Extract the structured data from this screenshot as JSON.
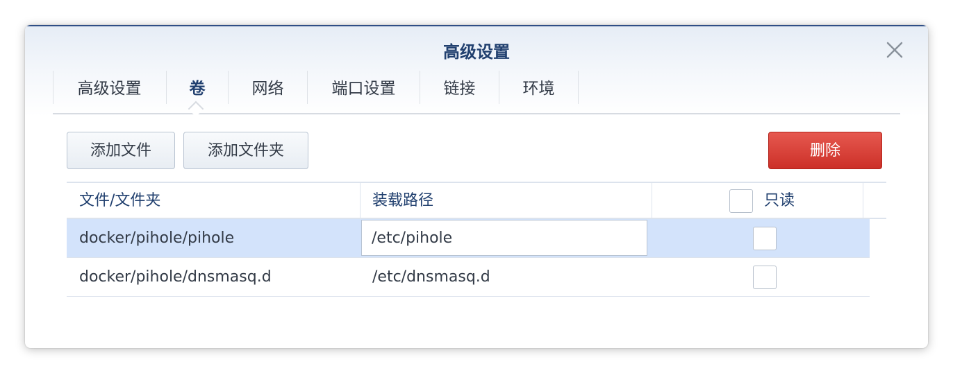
{
  "dialog": {
    "title": "高级设置",
    "close_icon": "close-icon"
  },
  "tabs": [
    {
      "label": "高级设置",
      "active": false
    },
    {
      "label": "卷",
      "active": true
    },
    {
      "label": "网络",
      "active": false
    },
    {
      "label": "端口设置",
      "active": false
    },
    {
      "label": "链接",
      "active": false
    },
    {
      "label": "环境",
      "active": false
    }
  ],
  "toolbar": {
    "add_file_label": "添加文件",
    "add_folder_label": "添加文件夹",
    "delete_label": "删除"
  },
  "table": {
    "columns": {
      "file_folder": "文件/文件夹",
      "mount_path": "装载路径",
      "read_only": "只读"
    },
    "read_only_all_checked": false,
    "rows": [
      {
        "file_folder": "docker/pihole/pihole",
        "mount_path": "/etc/pihole",
        "read_only": false,
        "selected": true,
        "editing": true
      },
      {
        "file_folder": "docker/pihole/dnsmasq.d",
        "mount_path": "/etc/dnsmasq.d",
        "read_only": false,
        "selected": false,
        "editing": false
      }
    ]
  },
  "colors": {
    "title": "#21406f",
    "selected_row": "#d3e3fb",
    "danger": "#cc3028"
  }
}
